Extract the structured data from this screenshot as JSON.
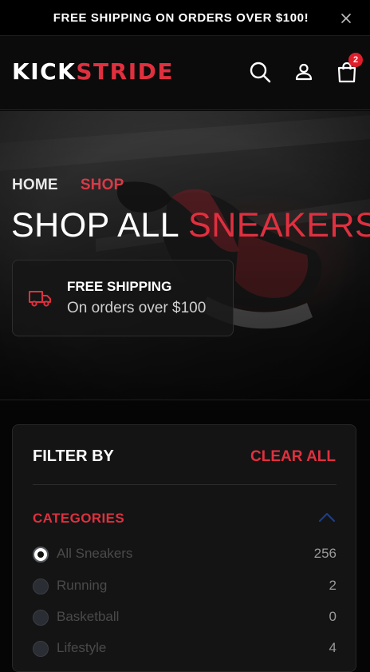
{
  "announcement": {
    "text": "FREE SHIPPING ON ORDERS OVER $100!",
    "close_icon": "close-icon"
  },
  "header": {
    "logo": {
      "part1": "KICK",
      "part2": "STRIDE"
    },
    "icons": [
      "search-icon",
      "user-icon",
      "shopping-bag-icon"
    ],
    "cart_count": "2"
  },
  "hero": {
    "breadcrumb": {
      "home": "HOME",
      "current": "SHOP"
    },
    "title": {
      "part1": "SHOP ALL",
      "part2": "SNEAKERS"
    },
    "shipping_card": {
      "icon": "truck-icon",
      "title": "FREE SHIPPING",
      "subtitle": "On orders over $100"
    }
  },
  "filter": {
    "title": "FILTER BY",
    "clear_label": "CLEAR ALL",
    "categories_title": "CATEGORIES",
    "categories_icon": "chevron-up-icon",
    "options": [
      {
        "label": "All Sneakers",
        "count": "256",
        "selected": true
      },
      {
        "label": "Running",
        "count": "2",
        "selected": false
      },
      {
        "label": "Basketball",
        "count": "0",
        "selected": false
      },
      {
        "label": "Lifestyle",
        "count": "4",
        "selected": false
      }
    ]
  },
  "colors": {
    "accent": "#e0303f",
    "badge": "#e01e2b",
    "background": "#050505",
    "panel": "#141414"
  }
}
